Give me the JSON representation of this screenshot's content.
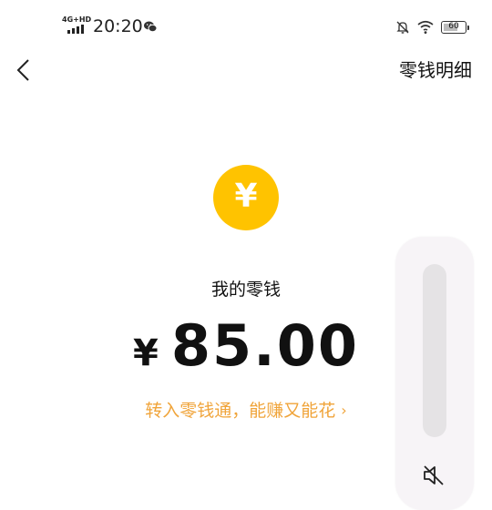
{
  "status_bar": {
    "network": "4G+HD",
    "time": "20:20",
    "battery": "60"
  },
  "nav": {
    "back_icon": "chevron-left-icon",
    "title_right": "零钱明细"
  },
  "wallet": {
    "coin_icon": "yuan-coin-icon",
    "coin_symbol": "¥",
    "label": "我的零钱",
    "currency": "¥",
    "amount": "85.00",
    "promo": "转入零钱通，能赚又能花",
    "promo_chevron": "›",
    "accent_color": "#ffc300",
    "promo_color": "#f0a43a"
  },
  "volume_panel": {
    "mute_icon": "speaker-muted-icon"
  }
}
